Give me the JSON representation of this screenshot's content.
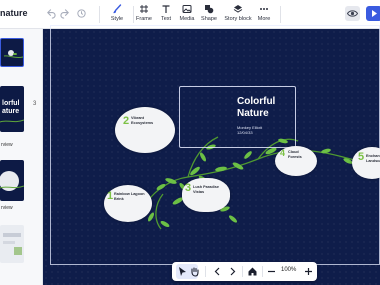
{
  "app": {
    "doc_title": "nature"
  },
  "toolbar": {
    "tools": [
      {
        "label": "Style",
        "icon": "brush-icon"
      },
      {
        "label": "Frame",
        "icon": "frame-icon"
      },
      {
        "label": "Text",
        "icon": "text-icon"
      },
      {
        "label": "Media",
        "icon": "image-icon"
      },
      {
        "label": "Shape",
        "icon": "shape-icon"
      },
      {
        "label": "Story block",
        "icon": "layers-icon"
      },
      {
        "label": "More",
        "icon": "more-icon"
      }
    ]
  },
  "sidebar": {
    "thumbnails": [
      {
        "label": "",
        "text": ""
      },
      {
        "label": "rview",
        "text": "lorful\nature"
      },
      {
        "label": "rview",
        "text": ""
      },
      {
        "label": "",
        "text": ""
      }
    ],
    "side_nums": [
      "3",
      "2"
    ]
  },
  "canvas": {
    "title": "Colorful Nature",
    "subtitle_line1": "Monkey Elliott",
    "subtitle_line2": "12/04/33",
    "cards": [
      {
        "num": "2",
        "title": "Vibrant\nEcosystems"
      },
      {
        "num": "1",
        "title": "Rainbow Lagoon\nBrink"
      },
      {
        "num": "3",
        "title": "Lush Paradise\nVistas"
      },
      {
        "num": "4",
        "title": "Cloud\nForests"
      },
      {
        "num": "5",
        "title": "Enchanted\nLandscapes"
      }
    ],
    "colors": {
      "background": "#0f1d4a",
      "accent": "#7cc145"
    }
  },
  "bottom_toolbar": {
    "zoom": "100%"
  }
}
